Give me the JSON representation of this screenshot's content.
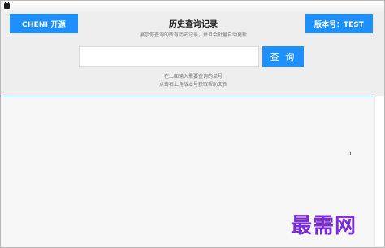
{
  "header": {
    "brand_label": "CHENI 开源",
    "title": "历史查询记录",
    "subtitle": "展示你查询的所有历史记录，并且会批量自动更新",
    "version_label": "版本号：TEST"
  },
  "search": {
    "value": "",
    "placeholder": "",
    "button_label": "查 询"
  },
  "hints": {
    "line1": "在上面输入需要查询的单号",
    "line2": "点击右上角版本号获取帮助文档"
  },
  "watermark": "最需网",
  "colors": {
    "accent": "#1e90ff",
    "header_bg": "#eeeeee",
    "watermark": "#7b2cd6"
  }
}
